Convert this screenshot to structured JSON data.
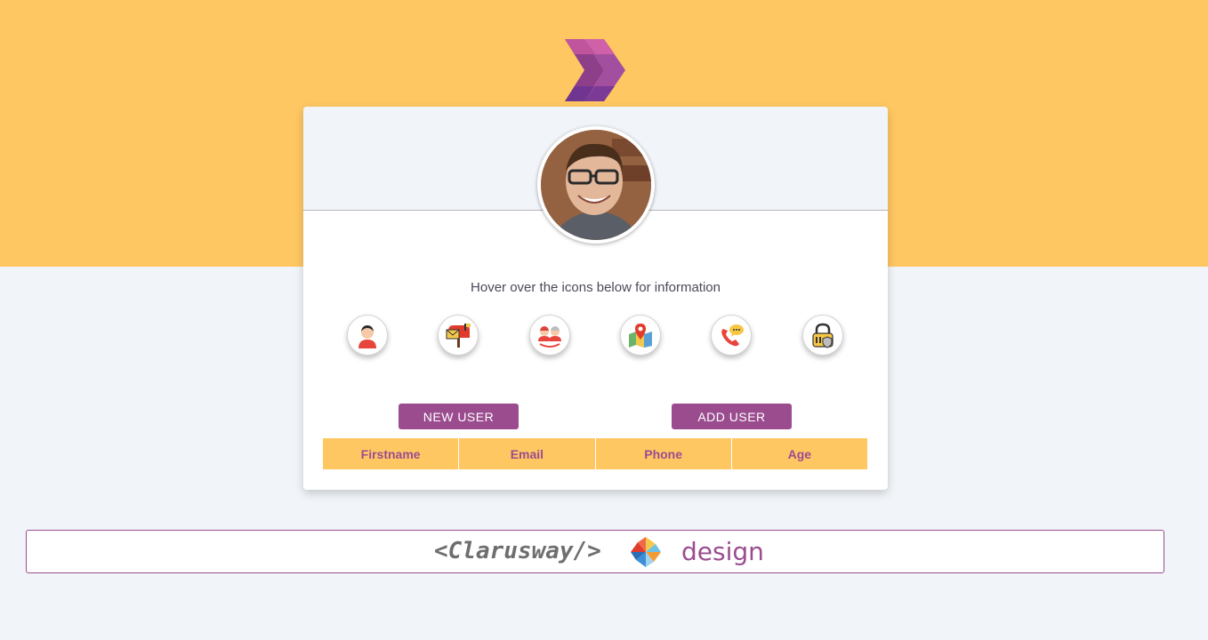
{
  "header": {
    "logo_icon": "double-chevron-logo-icon"
  },
  "card": {
    "avatar_icon": "profile-photo",
    "hint": "Hover over the icons below for information",
    "icons": [
      {
        "name": "user-icon"
      },
      {
        "name": "mailbox-icon"
      },
      {
        "name": "age-icon"
      },
      {
        "name": "map-icon"
      },
      {
        "name": "phone-icon"
      },
      {
        "name": "lock-icon"
      }
    ],
    "new_user_label": "NEW USER",
    "add_user_label": "ADD USER",
    "table": {
      "headers": [
        "Firstname",
        "Email",
        "Phone",
        "Age"
      ]
    }
  },
  "footer": {
    "brand": "<Clarusway/>",
    "brand_icon": "pinwheel-icon",
    "design": "design"
  },
  "colors": {
    "band": "#fec762",
    "background": "#f1f4f8",
    "accent": "#9b4c8f"
  }
}
